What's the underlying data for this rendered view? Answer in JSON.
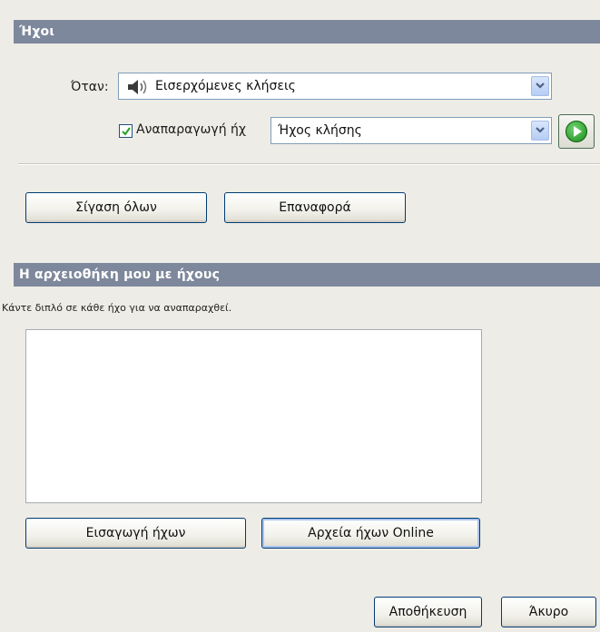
{
  "sounds_section": {
    "title": "Ήχοι",
    "when_label": "Όταν:",
    "event_select": {
      "value": "Εισερχόμενες κλήσεις",
      "icon": "speaker-icon"
    },
    "play_checkbox": {
      "label": "Αναπαραγωγή ήχ",
      "checked": true
    },
    "sound_select": {
      "value": "Ήχος κλήσης"
    },
    "play_button_icon": "play-icon",
    "mute_all_label": "Σίγαση όλων",
    "reset_label": "Επαναφορά"
  },
  "library_section": {
    "title": "Η αρχειοθήκη μου με ήχους",
    "hint": "Κάντε διπλό σε κάθε ήχο για να αναπαραχθεί.",
    "items": [],
    "import_label": "Εισαγωγή ήχων",
    "online_label": "Αρχεία ήχων Online"
  },
  "footer": {
    "save_label": "Αποθήκευση",
    "cancel_label": "Άκυρο"
  },
  "colors": {
    "section_bar": "#7e889c",
    "window_bg": "#eeece6",
    "button_border": "#003c74",
    "play_green": "#1a8c1a"
  }
}
